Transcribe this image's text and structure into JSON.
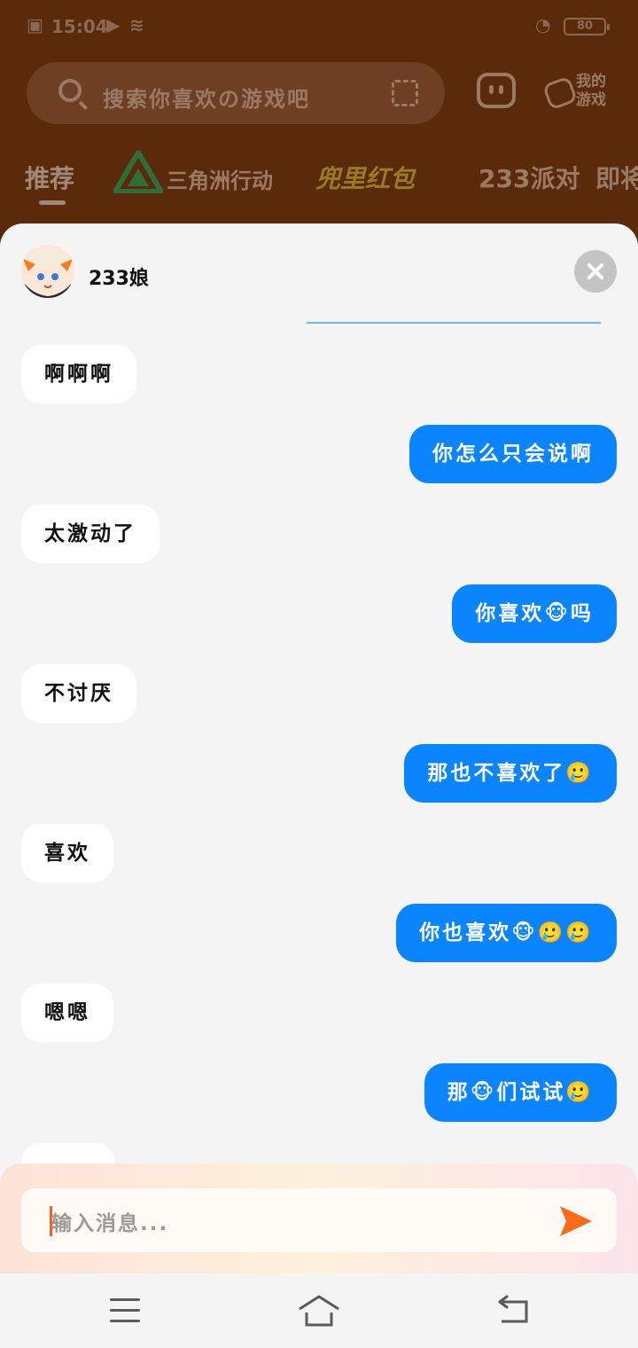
{
  "status_bar": {
    "time": "15:04",
    "battery": "80"
  },
  "header": {
    "search_placeholder": "搜索你喜欢の游戏吧",
    "my_games_label": "我的游戏"
  },
  "tabs": [
    {
      "label": "推荐"
    },
    {
      "label": "三角洲行动"
    },
    {
      "label": "兜里红包"
    },
    {
      "label": "233派对"
    },
    {
      "label": "即将"
    }
  ],
  "chat": {
    "bot_name": "233娘",
    "messages": [
      {
        "from": "bot",
        "text": "啊啊啊"
      },
      {
        "from": "user",
        "text": "你怎么只会说啊"
      },
      {
        "from": "bot",
        "text": "太激动了"
      },
      {
        "from": "user",
        "text": "你喜欢🐵吗"
      },
      {
        "from": "bot",
        "text": "不讨厌"
      },
      {
        "from": "user",
        "text": "那也不喜欢了🥲"
      },
      {
        "from": "bot",
        "text": "喜欢"
      },
      {
        "from": "user",
        "text": "你也喜欢🐵🥲🥲"
      },
      {
        "from": "bot",
        "text": "嗯嗯"
      },
      {
        "from": "user",
        "text": "那🐵们试试🥲"
      }
    ],
    "input_placeholder": "输入消息..."
  },
  "colors": {
    "user_bubble": "#0a84ff",
    "bot_bubble": "#ffffff",
    "send_accent": "#ff6a1a",
    "backdrop": "#5a2a0a"
  }
}
